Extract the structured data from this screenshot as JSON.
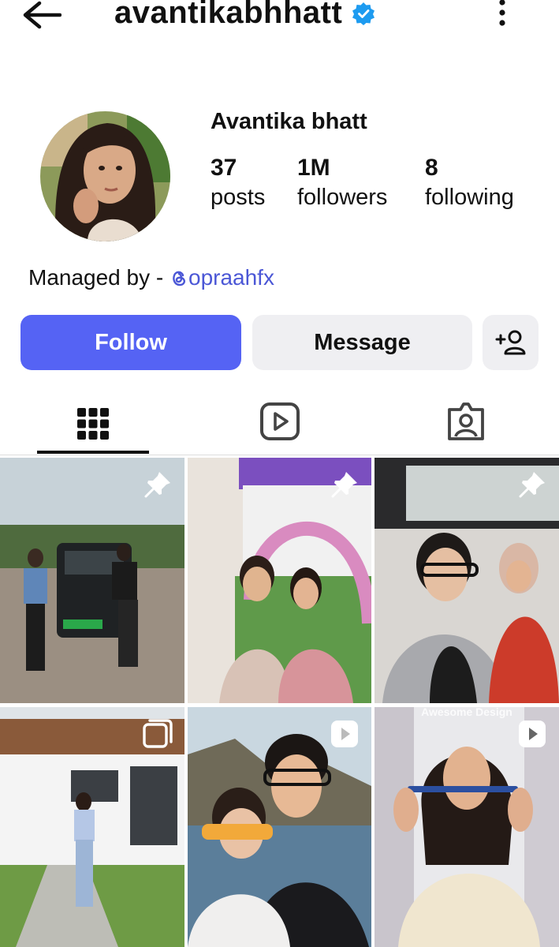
{
  "header": {
    "username": "avantikabhhatt",
    "verified": true,
    "icons": {
      "back": "arrow-left-icon",
      "more": "more-vertical-icon",
      "verified": "verified-badge-icon"
    }
  },
  "profile": {
    "display_name": "Avantika bhatt",
    "stats": [
      {
        "value": "37",
        "label": "posts"
      },
      {
        "value": "1M",
        "label": "followers"
      },
      {
        "value": "8",
        "label": "following"
      }
    ],
    "bio_prefix": "Managed by - ",
    "bio_threads_icon": "threads-icon",
    "bio_handle": "opraahfx"
  },
  "actions": {
    "follow_label": "Follow",
    "message_label": "Message",
    "add_user_icon": "add-user-icon"
  },
  "tabs": [
    {
      "name": "posts",
      "icon": "grid-icon",
      "active": true
    },
    {
      "name": "reels",
      "icon": "reels-icon",
      "active": false
    },
    {
      "name": "tagged",
      "icon": "tagged-icon",
      "active": false
    }
  ],
  "posts": [
    {
      "id": 1,
      "badge": "pin-icon"
    },
    {
      "id": 2,
      "badge": "pin-icon"
    },
    {
      "id": 3,
      "badge": "pin-icon"
    },
    {
      "id": 4,
      "badge": "carousel-icon"
    },
    {
      "id": 5,
      "badge": "reel-play-icon"
    },
    {
      "id": 6,
      "badge": "reel-play-icon",
      "overlay_text": "Awesome Design"
    }
  ],
  "colors": {
    "accent": "#5563f4",
    "link": "#4b57d6",
    "verified": "#1d9bf0",
    "button_secondary": "#efeff2"
  }
}
